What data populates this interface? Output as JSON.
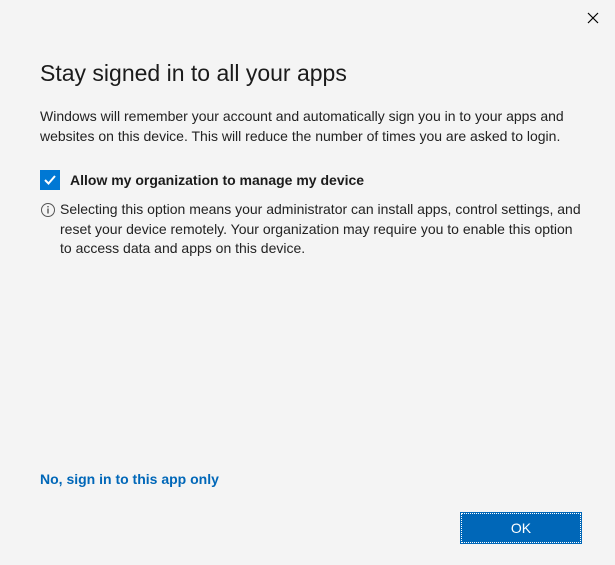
{
  "title": "Stay signed in to all your apps",
  "description": "Windows will remember your account and automatically sign you in to your apps and websites on this device. This will reduce the number of times you are asked to login.",
  "checkbox": {
    "label": "Allow my organization to manage my device",
    "checked": true
  },
  "info_text": "Selecting this option means your administrator can install apps, control settings, and reset your device remotely. Your organization may require you to enable this option to access data and apps on this device.",
  "link_text": "No, sign in to this app only",
  "ok_label": "OK",
  "close_label": "✕",
  "colors": {
    "accent": "#0078d4",
    "link": "#0067b8"
  }
}
